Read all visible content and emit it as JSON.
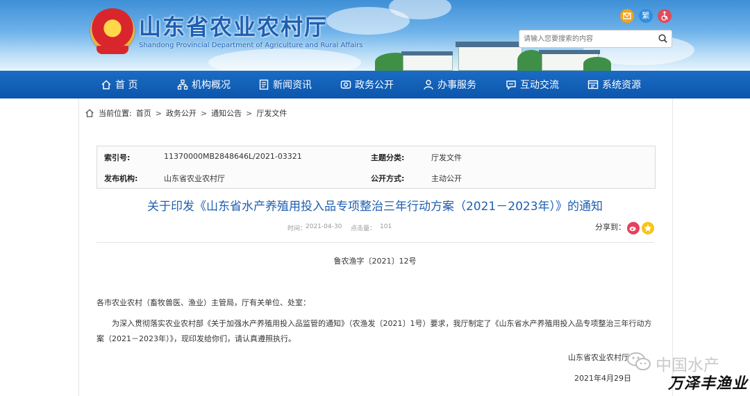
{
  "header": {
    "site_name": "山东省农业农村厅",
    "site_name_en": "Shandong Provincial Department of Agriculture and Rural Affairs",
    "icons": [
      "mail-icon",
      "accessibility-text-icon",
      "wheelchair-icon"
    ],
    "accessibility_label": "繁",
    "search_placeholder": "请输入您要搜索的内容"
  },
  "nav": [
    {
      "label": "首 页",
      "icon": "home-icon"
    },
    {
      "label": "机构概况",
      "icon": "org-chart-icon"
    },
    {
      "label": "新闻资讯",
      "icon": "news-icon"
    },
    {
      "label": "政务公开",
      "icon": "disclosure-icon"
    },
    {
      "label": "办事服务",
      "icon": "service-icon"
    },
    {
      "label": "互动交流",
      "icon": "chat-icon"
    },
    {
      "label": "系统资源",
      "icon": "system-icon"
    }
  ],
  "breadcrumb": {
    "prefix": "当前位置:",
    "items": [
      "首页",
      "政务公开",
      "通知公告",
      "厅发文件"
    ]
  },
  "meta": {
    "index_label": "索引号:",
    "index_value": "11370000MB2848646L/2021-03321",
    "topic_label": "主题分类:",
    "topic_value": "厅发文件",
    "publisher_label": "发布机构:",
    "publisher_value": "山东省农业农村厅",
    "open_label": "公开方式:",
    "open_value": "主动公开"
  },
  "article": {
    "title": "关于印发《山东省水产养殖用投入品专项整治三年行动方案（2021－2023年）》的通知",
    "time_label": "时间：",
    "time_value": "2021-04-30",
    "clicks_label": "点击量：",
    "clicks_value": "101",
    "share_label": "分享到：",
    "doc_number": "鲁农渔字〔2021〕12号",
    "addressee": "各市农业农村（畜牧兽医、渔业）主管局，厅有关单位、处室：",
    "body": "为深入贯彻落实农业农村部《关于加强水产养殖用投入品监管的通知》（农渔发〔2021〕1号）要求，我厅制定了《山东省水产养殖用投入品专项整治三年行动方案（2021－2023年）》，现印发给你们，请认真遵照执行。",
    "signature": "山东省农业农村厅",
    "date": "2021年4月29日"
  },
  "watermark": {
    "line1": "中国水产",
    "line2": "万泽丰渔业"
  },
  "colors": {
    "nav_bg": "#0c56ac",
    "title": "#1f5fb0",
    "mail": "#f2a21b",
    "accessibility": "#2f8ee0",
    "wheelchair": "#e04b5a",
    "weibo": "#e6405d",
    "qzone": "#f5c518"
  }
}
